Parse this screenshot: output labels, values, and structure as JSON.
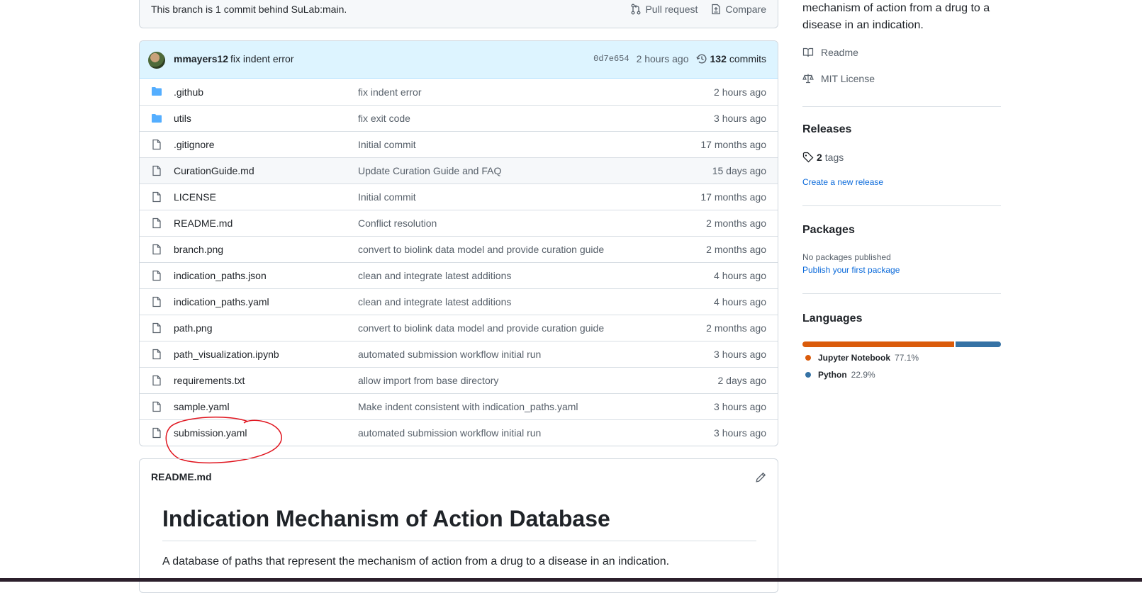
{
  "branch": {
    "status": "This branch is 1 commit behind SuLab:main.",
    "pull_request": "Pull request",
    "compare": "Compare"
  },
  "latest_commit": {
    "author": "mmayers12",
    "message": "fix indent error",
    "sha": "0d7e654",
    "age": "2 hours ago",
    "count": "132",
    "count_label": "commits"
  },
  "files": [
    {
      "name": ".github",
      "type": "folder",
      "message": "fix indent error",
      "age": "2 hours ago"
    },
    {
      "name": "utils",
      "type": "folder",
      "message": "fix exit code",
      "age": "3 hours ago"
    },
    {
      "name": ".gitignore",
      "type": "file",
      "message": "Initial commit",
      "age": "17 months ago"
    },
    {
      "name": "CurationGuide.md",
      "type": "file",
      "message": "Update Curation Guide and FAQ",
      "age": "15 days ago"
    },
    {
      "name": "LICENSE",
      "type": "file",
      "message": "Initial commit",
      "age": "17 months ago"
    },
    {
      "name": "README.md",
      "type": "file",
      "message": "Conflict resolution",
      "age": "2 months ago"
    },
    {
      "name": "branch.png",
      "type": "file",
      "message": "convert to biolink data model and provide curation guide",
      "age": "2 months ago"
    },
    {
      "name": "indication_paths.json",
      "type": "file",
      "message": "clean and integrate latest additions",
      "age": "4 hours ago"
    },
    {
      "name": "indication_paths.yaml",
      "type": "file",
      "message": "clean and integrate latest additions",
      "age": "4 hours ago"
    },
    {
      "name": "path.png",
      "type": "file",
      "message": "convert to biolink data model and provide curation guide",
      "age": "2 months ago"
    },
    {
      "name": "path_visualization.ipynb",
      "type": "file",
      "message": "automated submission workflow initial run",
      "age": "3 hours ago"
    },
    {
      "name": "requirements.txt",
      "type": "file",
      "message": "allow import from base directory",
      "age": "2 days ago"
    },
    {
      "name": "sample.yaml",
      "type": "file",
      "message": "Make indent consistent with indication_paths.yaml",
      "age": "3 hours ago"
    },
    {
      "name": "submission.yaml",
      "type": "file",
      "message": "automated submission workflow initial run",
      "age": "3 hours ago"
    }
  ],
  "readme": {
    "filename": "README.md",
    "heading": "Indication Mechanism of Action Database",
    "paragraph": "A database of paths that represent the mechanism of action from a drug to a disease in an indication."
  },
  "sidebar": {
    "about_desc_line1": "mechanism of action from a drug to a",
    "about_desc_line2": "disease in an indication.",
    "readme_link": "Readme",
    "license_link": "MIT License",
    "releases_heading": "Releases",
    "tags_count": "2",
    "tags_label": "tags",
    "create_release": "Create a new release",
    "packages_heading": "Packages",
    "no_packages": "No packages published",
    "publish_package": "Publish your first package",
    "languages_heading": "Languages",
    "languages": [
      {
        "name": "Jupyter Notebook",
        "percent": "77.1%",
        "value": 77.1,
        "color": "#DA5B0B"
      },
      {
        "name": "Python",
        "percent": "22.9%",
        "value": 22.9,
        "color": "#3572A5"
      }
    ]
  },
  "colors": {
    "accent": "#0969da",
    "commit_header_bg": "#ddf4ff",
    "annotation": "#e0141e"
  }
}
